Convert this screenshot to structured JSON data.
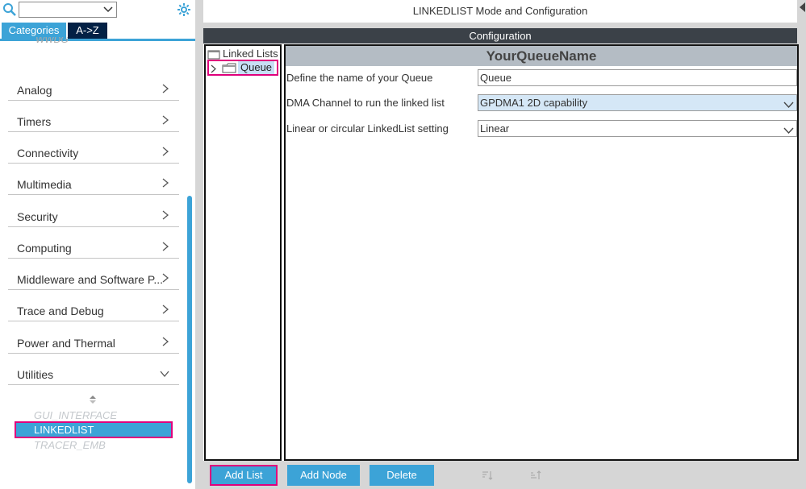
{
  "sidebar": {
    "search_value": "",
    "tabs": {
      "categories": "Categories",
      "az": "A->Z"
    },
    "clipped_item": "WWDG",
    "categories": [
      {
        "label": "Analog"
      },
      {
        "label": "Timers"
      },
      {
        "label": "Connectivity"
      },
      {
        "label": "Multimedia"
      },
      {
        "label": "Security"
      },
      {
        "label": "Computing"
      },
      {
        "label": "Middleware and Software P..."
      },
      {
        "label": "Trace and Debug"
      },
      {
        "label": "Power and Thermal"
      },
      {
        "label": "Utilities"
      }
    ],
    "utilities": {
      "items": [
        "GUI_INTERFACE",
        "LINKEDLIST",
        "TRACER_EMB"
      ],
      "selected": "LINKEDLIST"
    }
  },
  "main": {
    "mode_title": "LINKEDLIST Mode and Configuration",
    "config_title": "Configuration",
    "tree": {
      "root_label": "Linked Lists",
      "queue_label": "Queue"
    },
    "form": {
      "title": "YourQueueName",
      "fields": [
        {
          "label": "Define the name of your Queue",
          "value": "Queue"
        },
        {
          "label": "DMA Channel to run the linked list",
          "value": "GPDMA1 2D capability"
        },
        {
          "label": "Linear or circular LinkedList setting",
          "value": "Linear"
        }
      ]
    },
    "buttons": {
      "add_list": "Add List",
      "add_node": "Add Node",
      "delete": "Delete"
    }
  },
  "colors": {
    "accent": "#3ca3d7",
    "highlight_border": "#e0007c",
    "dark_header": "#3b4148",
    "tab_dark": "#032145"
  }
}
